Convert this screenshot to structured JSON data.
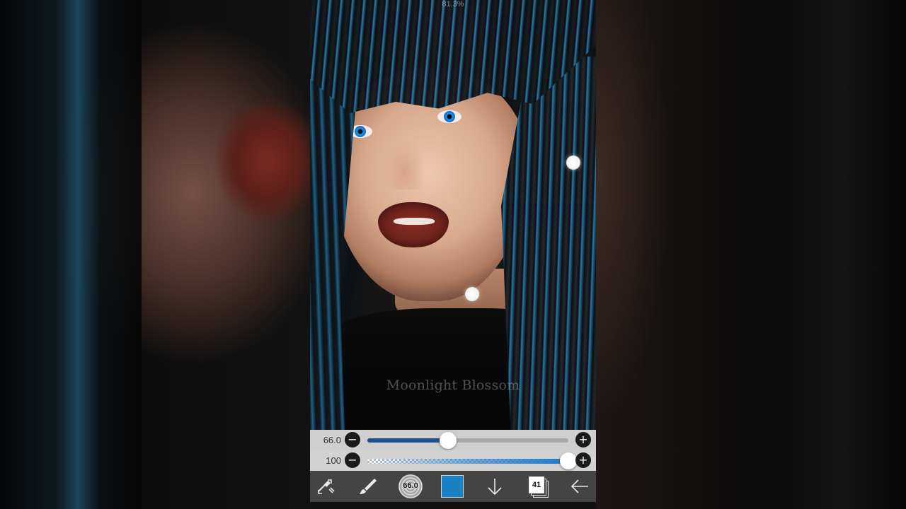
{
  "canvas": {
    "zoom_text": "81.3%",
    "watermark": "Moonlight Blossom"
  },
  "sliders": {
    "size": {
      "value_text": "66.0",
      "fraction": 0.4,
      "minus": "−",
      "plus": "+"
    },
    "opacity": {
      "value_text": "100",
      "fraction": 1.0,
      "minus": "−",
      "plus": "+"
    }
  },
  "toolbar": {
    "brush_size_text": "66.0",
    "layer_count": "41",
    "color_hex": "#1a82c4",
    "icons": [
      "transform-icon",
      "brush-icon",
      "brush-preview",
      "color-swatch",
      "download-icon",
      "layers-icon",
      "back-arrow-icon"
    ]
  }
}
